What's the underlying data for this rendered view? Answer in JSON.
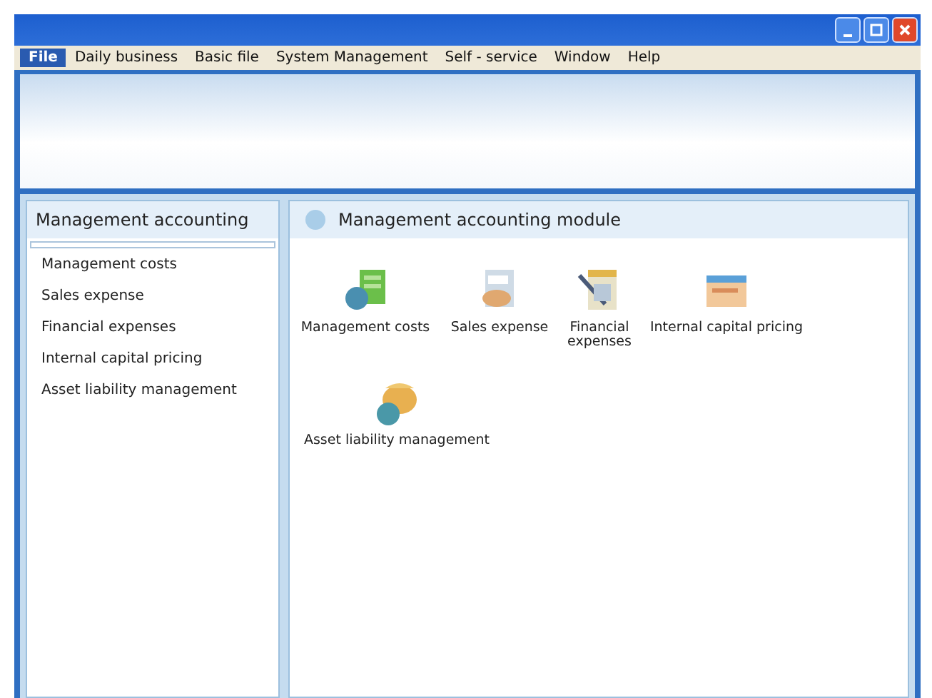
{
  "menu": [
    {
      "label": "File",
      "selected": true
    },
    {
      "label": "Daily business",
      "selected": false
    },
    {
      "label": "Basic file",
      "selected": false
    },
    {
      "label": "System Management",
      "selected": false
    },
    {
      "label": "Self - service",
      "selected": false
    },
    {
      "label": "Window",
      "selected": false
    },
    {
      "label": "Help",
      "selected": false
    }
  ],
  "sidebar": {
    "title": "Management accounting",
    "items": [
      "Management costs",
      "Sales expense",
      "Financial expenses",
      "Internal capital pricing",
      "Asset liability management"
    ]
  },
  "module": {
    "title": "Management accounting module",
    "items": [
      {
        "label": "Management costs",
        "kind": "chart"
      },
      {
        "label": "Sales expense",
        "kind": "deal"
      },
      {
        "label": "Financial expenses",
        "kind": "calculator"
      },
      {
        "label": "Internal capital pricing",
        "kind": "window"
      },
      {
        "label": "Asset liability management",
        "kind": "money"
      }
    ]
  }
}
